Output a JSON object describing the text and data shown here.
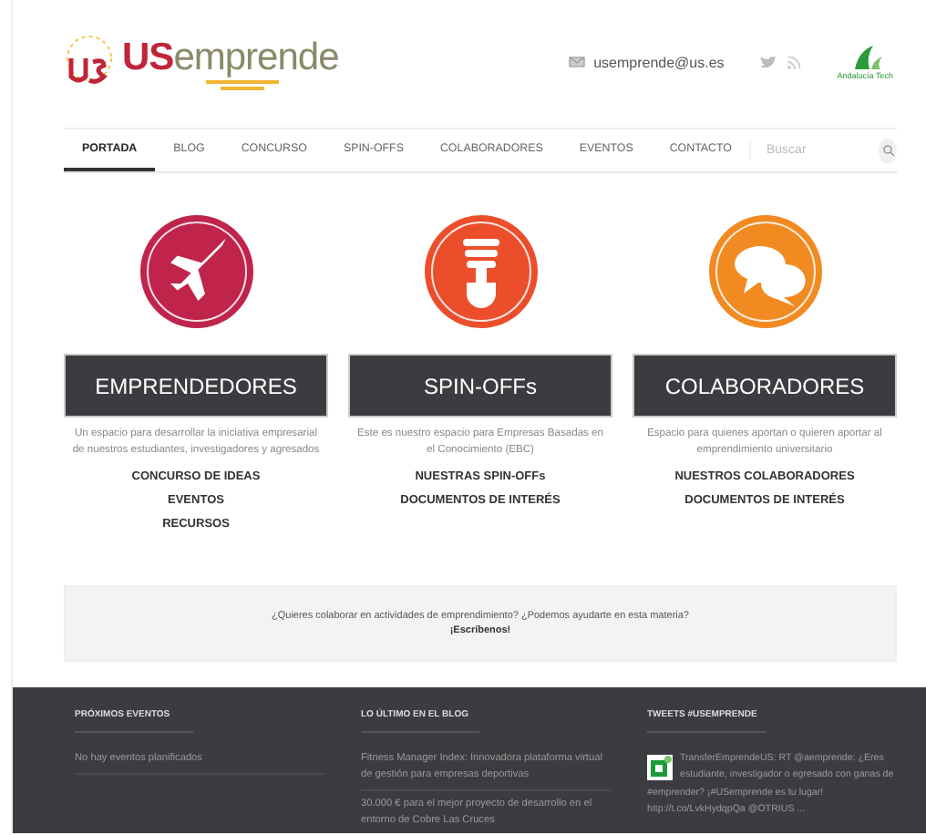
{
  "header": {
    "logo": {
      "prefix": "US",
      "name": "emprende"
    },
    "email": "usemprende@us.es",
    "partner": "Andalucía Tech"
  },
  "nav": {
    "items": [
      {
        "label": "PORTADA",
        "selected": true
      },
      {
        "label": "BLOG",
        "selected": false
      },
      {
        "label": "CONCURSO",
        "selected": false
      },
      {
        "label": "SPIN-OFFS",
        "selected": false
      },
      {
        "label": "COLABORADORES",
        "selected": false
      },
      {
        "label": "EVENTOS",
        "selected": false
      },
      {
        "label": "CONTACTO",
        "selected": false
      }
    ],
    "search": {
      "placeholder": "Buscar"
    }
  },
  "features": [
    {
      "kind": "plane",
      "color": "#c0244a",
      "title": "EMPRENDEDORES",
      "description": "Un espacio para desarrollar la iniciativa empresarial de nuestros estudiantes, investigadores y agresados",
      "links": [
        "CONCURSO DE IDEAS",
        "EVENTOS",
        "RECURSOS"
      ]
    },
    {
      "kind": "bulb",
      "color": "#ec4e2c",
      "title": "SPIN-OFFs",
      "description": "Este es nuestro espacio para Empresas Basadas en el Conocimiento (EBC)",
      "links": [
        "NUESTRAS SPIN-OFFs",
        "DOCUMENTOS DE INTERÉS"
      ]
    },
    {
      "kind": "chat",
      "color": "#f28a22",
      "title": "COLABORADORES",
      "description": "Espacio para quienes aportan o quieren aportar al emprendimiento universitario",
      "links": [
        "NUESTROS COLABORADORES",
        "DOCUMENTOS DE INTERÉS"
      ]
    }
  ],
  "callout": {
    "text": "¿Quieres colaborar en actividades de emprendimiento? ¿Podemos ayudarte en esta materia?",
    "link": "¡Escríbenos!"
  },
  "footer": {
    "columns": [
      {
        "title": "PRÓXIMOS EVENTOS",
        "items": [
          "No hay eventos planificados"
        ]
      },
      {
        "title": "LO ÚLTIMO EN EL BLOG",
        "items": [
          "Fitness Manager Index: Innovadora plataforma virtual de gestión para empresas deportivas",
          "30.000 € para el mejor proyecto de desarrollo en el entorno de Cobre Las Cruces"
        ]
      },
      {
        "title": "TWEETS #USEMPRENDE",
        "tweet": "TransferEmprendeUS: RT @aemprende: ¿Eres estudiante, investigador o egresado con ganas de #emprender? ¡#USemprende es tu lugar! http://t.co/LvkHydqpQa @OTRIUS ..."
      }
    ]
  }
}
